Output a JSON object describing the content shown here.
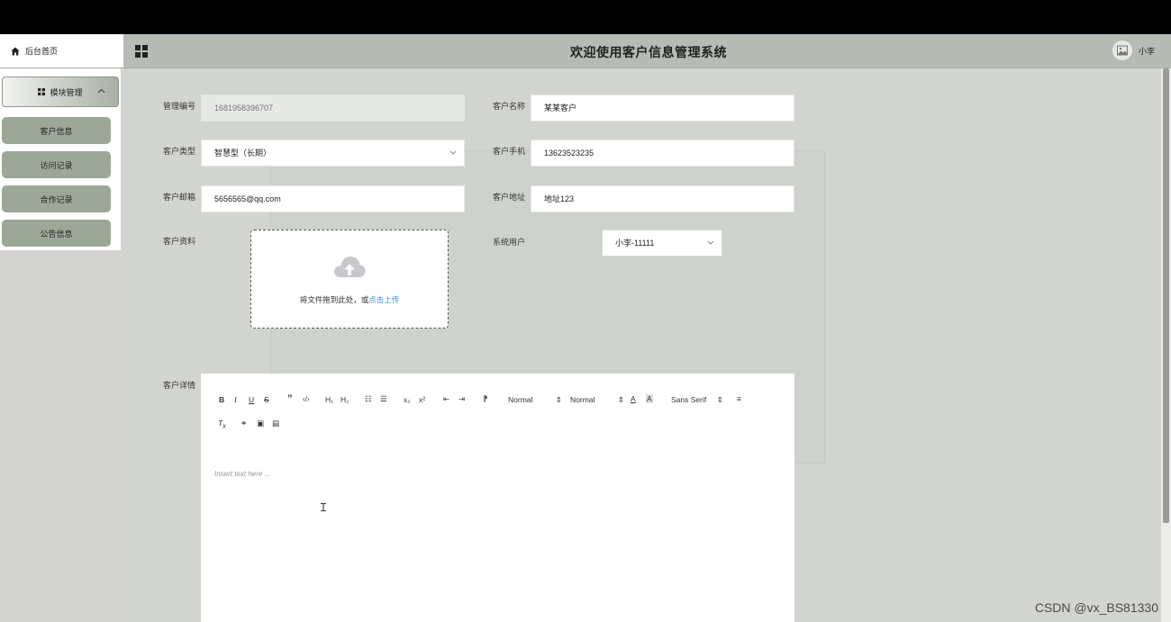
{
  "header": {
    "home_tab": "后台首页",
    "title": "欢迎使用客户信息管理系统",
    "user_name": "小李"
  },
  "sidebar": {
    "module_label": "模块管理",
    "items": [
      {
        "label": "客户信息"
      },
      {
        "label": "访问记录"
      },
      {
        "label": "合作记录"
      },
      {
        "label": "公告信息"
      }
    ]
  },
  "form": {
    "manage_id_label": "管理编号",
    "manage_id_value": "1681958396707",
    "customer_name_label": "客户名称",
    "customer_name_value": "某某客户",
    "customer_type_label": "客户类型",
    "customer_type_value": "智慧型（长期）",
    "customer_phone_label": "客户手机",
    "customer_phone_value": "13623523235",
    "customer_email_label": "客户邮箱",
    "customer_email_value": "5656565@qq.com",
    "customer_address_label": "客户地址",
    "customer_address_value": "地址123",
    "customer_material_label": "客户资料",
    "upload_text": "将文件拖到此处，或",
    "upload_link": "点击上传",
    "system_user_label": "系统用户",
    "system_user_value": "小李-11111",
    "customer_detail_label": "客户详情"
  },
  "editor": {
    "header_select": "Normal",
    "size_select": "Normal",
    "font_select": "Sans Serif",
    "placeholder": "Insert text here ..."
  },
  "watermark": "CSDN @vx_BS81330"
}
